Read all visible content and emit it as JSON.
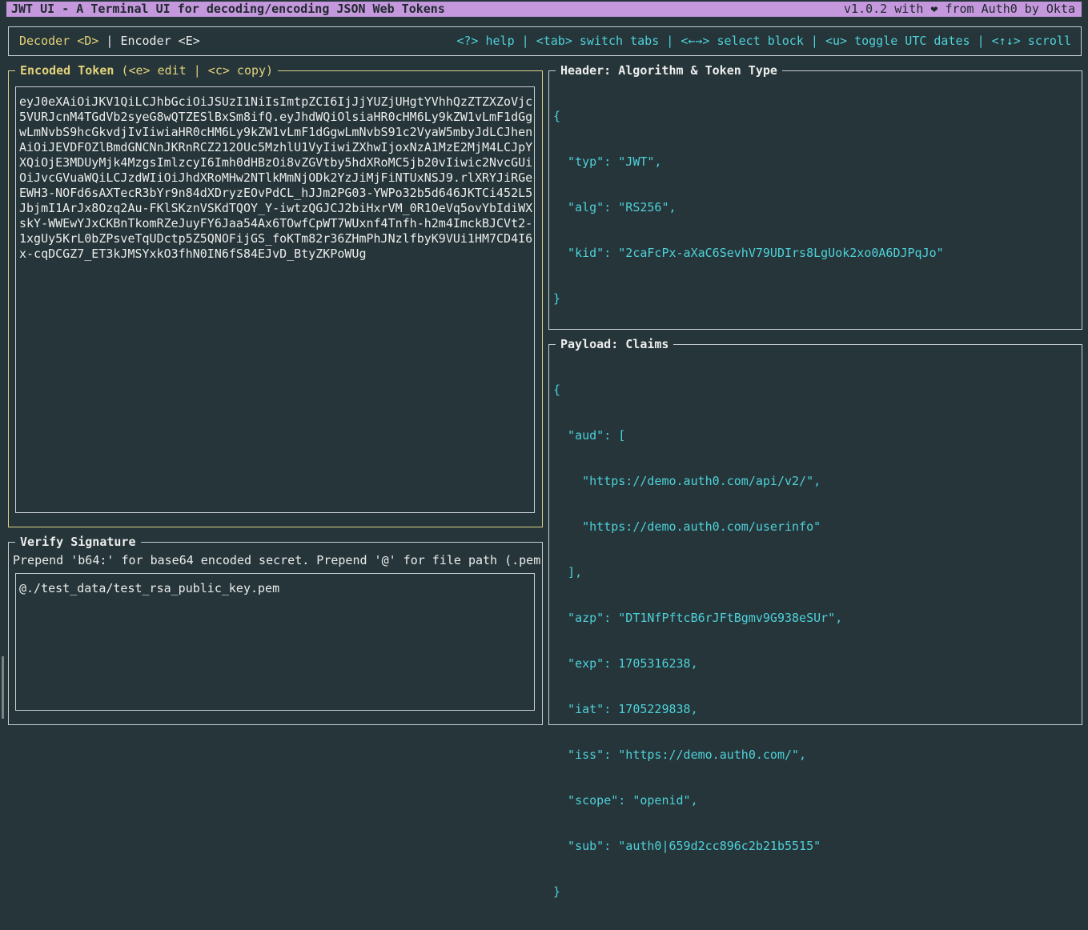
{
  "app": {
    "title": "JWT UI - A Terminal UI for decoding/encoding JSON Web Tokens",
    "version_info": "v1.0.2 with ❤ from Auth0 by Okta"
  },
  "tabs": [
    {
      "label": "Decoder <D>",
      "active": true
    },
    {
      "label": "Encoder <E>",
      "active": false
    }
  ],
  "tab_separator": "|",
  "help_text": "<?> help | <tab> switch tabs | <←→> select block | <u> toggle UTC dates | <↑↓> scroll",
  "encoded_token": {
    "title": "Encoded Token",
    "hint": "(<e> edit | <c> copy)",
    "value": "eyJ0eXAiOiJKV1QiLCJhbGciOiJSUzI1NiIsImtpZCI6IjJjYUZjUHgtYVhhQzZTZXZoVjc5VURJcnM4TGdVb2syeG8wQTZESlBxSm8ifQ.eyJhdWQiOlsiaHR0cHM6Ly9kZW1vLmF1dGgwLmNvbS9hcGkvdjIvIiwiaHR0cHM6Ly9kZW1vLmF1dGgwLmNvbS91c2VyaW5mbyJdLCJhenAiOiJEVDFOZlBmdGNCNnJKRnRCZ212OUc5MzhlU1VyIiwiZXhwIjoxNzA1MzE2MjM4LCJpYXQiOjE3MDUyMjk4MzgsImlzcyI6Imh0dHBzOi8vZGVtby5hdXRoMC5jb20vIiwic2NvcGUiOiJvcGVuaWQiLCJzdWIiOiJhdXRoMHw2NTlkMmNjODk2YzJiMjFiNTUxNSJ9.rlXRYJiRGeEWH3-NOFd6sAXTecR3bYr9n84dXDryzEOvPdCL_hJJm2PG03-YWPo32b5d646JKTCi452L5JbjmI1ArJx8Ozq2Au-FKlSKznVSKdTQOY_Y-iwtzQGJCJ2biHxrVM_0R1OeVq5ovYbIdiWXskY-WWEwYJxCKBnTkomRZeJuyFY6Jaa54Ax6TOwfCpWT7WUxnf4Tnfh-h2m4ImckBJCVt2-1xgUy5KrL0bZPsveTqUDctp5Z5QNOFijGS_foKTm82r36ZHmPhJNzlfbyK9VUi1HM7CD4I6x-cqDCGZ7_ET3kJMSYxkO3fhN0IN6fS84EJvD_BtyZKPoWUg"
  },
  "verify_signature": {
    "title": "Verify Signature",
    "hint": "Prepend 'b64:' for base64 encoded secret. Prepend '@' for file path (.pem",
    "value": "@./test_data/test_rsa_public_key.pem"
  },
  "header_panel": {
    "title": "Header: Algorithm & Token Type",
    "json_lines": [
      "{",
      "  \"typ\": \"JWT\",",
      "  \"alg\": \"RS256\",",
      "  \"kid\": \"2caFcPx-aXaC6SevhV79UDIrs8LgUok2xo0A6DJPqJo\"",
      "}"
    ]
  },
  "payload_panel": {
    "title": "Payload: Claims",
    "json_lines": [
      "{",
      "  \"aud\": [",
      "    \"https://demo.auth0.com/api/v2/\",",
      "    \"https://demo.auth0.com/userinfo\"",
      "  ],",
      "  \"azp\": \"DT1NfPftcB6rJFtBgmv9G938eSUr\",",
      "  \"exp\": 1705316238,",
      "  \"iat\": 1705229838,",
      "  \"iss\": \"https://demo.auth0.com/\",",
      "  \"scope\": \"openid\",",
      "  \"sub\": \"auth0|659d2cc896c2b21b5515\"",
      "}"
    ]
  },
  "colors": {
    "background": "#253539",
    "title_bar": "#c597dc",
    "active_tab": "#e4d27a",
    "json_text": "#4fd1d9",
    "focused_border": "#d9d28a"
  }
}
